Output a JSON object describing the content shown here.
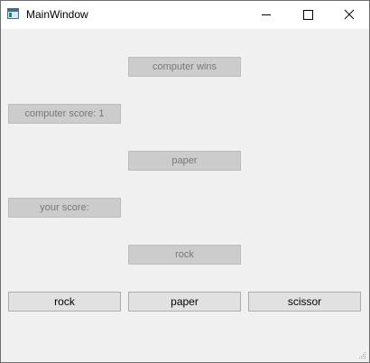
{
  "window": {
    "title": "MainWindow",
    "controls": [
      "minimize-icon",
      "maximize-icon",
      "close-icon"
    ]
  },
  "labels": {
    "result": "computer wins",
    "computer_score": "computer score: 1",
    "computer_choice": "paper",
    "your_score": "your score:",
    "your_choice": "rock"
  },
  "buttons": {
    "rock": "rock",
    "paper": "paper",
    "scissor": "scissor"
  },
  "colors": {
    "window_bg": "#f0f0f0",
    "label_bg": "#cccccc",
    "label_text": "#787878",
    "button_bg": "#e1e1e1",
    "button_border": "#adadad"
  }
}
